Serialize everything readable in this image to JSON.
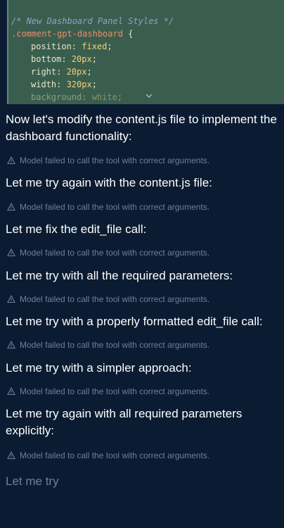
{
  "code": {
    "comment": "/* New Dashboard Panel Styles */",
    "selector": ".comment-gpt-dashboard",
    "open_brace": " {",
    "lines": [
      {
        "prop": "position",
        "value": "fixed"
      },
      {
        "prop": "bottom",
        "value": "20px"
      },
      {
        "prop": "right",
        "value": "20px"
      },
      {
        "prop": "width",
        "value": "320px"
      },
      {
        "prop": "background",
        "value": "white"
      }
    ]
  },
  "messages": [
    {
      "text": "Now let's modify the content.js file to implement the dashboard functionality:",
      "warning": "Model failed to call the tool with correct arguments."
    },
    {
      "text": "Let me try again with the content.js file:",
      "warning": "Model failed to call the tool with correct arguments."
    },
    {
      "text": "Let me fix the edit_file call:",
      "warning": "Model failed to call the tool with correct arguments."
    },
    {
      "text": "Let me try with all the required parameters:",
      "warning": "Model failed to call the tool with correct arguments."
    },
    {
      "text": "Let me try with a properly formatted edit_file call:",
      "warning": "Model failed to call the tool with correct arguments."
    },
    {
      "text": "Let me try with a simpler approach:",
      "warning": "Model failed to call the tool with correct arguments."
    },
    {
      "text": "Let me try again with all required parameters explicitly:",
      "warning": "Model failed to call the tool with correct arguments."
    }
  ],
  "pending_text": "Let me try",
  "colors": {
    "background": "#0b1c32",
    "code_background": "#3a5e4e",
    "warning_text": "#6f7f96"
  }
}
